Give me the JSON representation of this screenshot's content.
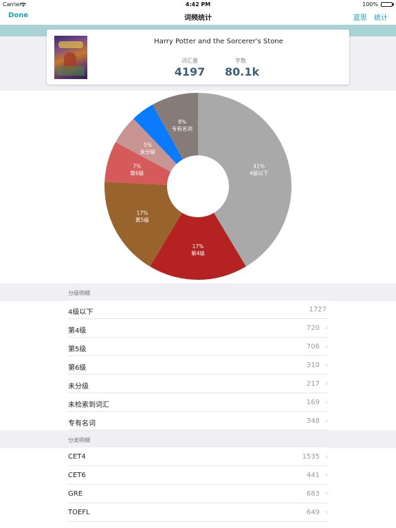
{
  "status_bar": {
    "carrier": "Carrier",
    "time": "4:42 PM",
    "battery": "100%"
  },
  "nav": {
    "done": "Done",
    "title": "词频统计",
    "right_items": [
      "蓝思",
      "统计"
    ]
  },
  "book": {
    "title": "Harry Potter and the Sorcerer's Stone",
    "vocab_label": "词汇量",
    "vocab_value": "4197",
    "words_label": "字数",
    "words_value": "80.1k"
  },
  "chart_data": {
    "type": "pie",
    "slices": [
      {
        "label": "4级以下",
        "percent": 41,
        "percent_text": "41%",
        "color": "#a9a9a9"
      },
      {
        "label": "第4级",
        "percent": 17,
        "percent_text": "17%",
        "color": "#b42222"
      },
      {
        "label": "第5级",
        "percent": 17,
        "percent_text": "17%",
        "color": "#99632e"
      },
      {
        "label": "第6级",
        "percent": 7,
        "percent_text": "7%",
        "color": "#d65a5a"
      },
      {
        "label": "未分级",
        "percent": 5,
        "percent_text": "5%",
        "color": "#c99494"
      },
      {
        "label": "",
        "percent": 4,
        "percent_text": "",
        "color": "#0a7bff"
      },
      {
        "label": "专有名词",
        "percent": 8,
        "percent_text": "8%",
        "color": "#877b77"
      }
    ]
  },
  "sections": {
    "level_header": "分级明细",
    "level_rows": [
      {
        "name": "4级以下",
        "count": "1727",
        "chevron": false
      },
      {
        "name": "第4级",
        "count": "720",
        "chevron": true
      },
      {
        "name": "第5级",
        "count": "706",
        "chevron": true
      },
      {
        "name": "第6级",
        "count": "310",
        "chevron": true
      },
      {
        "name": "未分级",
        "count": "217",
        "chevron": true
      },
      {
        "name": "未检索到词汇",
        "count": "169",
        "chevron": true
      },
      {
        "name": "专有名词",
        "count": "348",
        "chevron": true
      }
    ],
    "category_header": "分类明细",
    "category_rows": [
      {
        "name": "CET4",
        "count": "1535",
        "chevron": true
      },
      {
        "name": "CET6",
        "count": "441",
        "chevron": true
      },
      {
        "name": "GRE",
        "count": "683",
        "chevron": true
      },
      {
        "name": "TOEFL",
        "count": "649",
        "chevron": true
      }
    ]
  }
}
